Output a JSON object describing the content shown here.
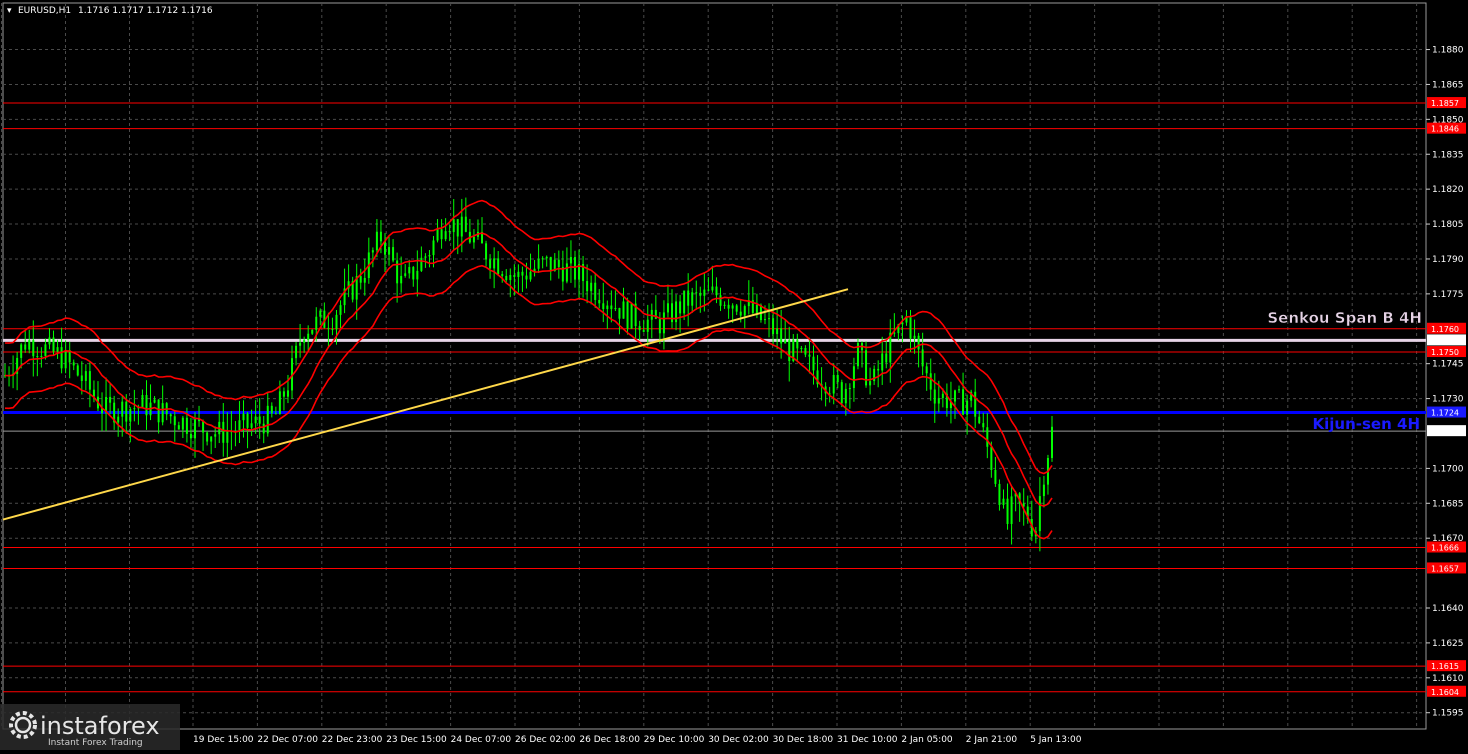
{
  "header": {
    "symbol": "EURUSD,H1",
    "ohlc": "1.1716 1.1717 1.1712 1.1716"
  },
  "chart_data": {
    "type": "candlestick",
    "instrument": "EURUSD",
    "timeframe": "H1",
    "ylim": [
      1.1588,
      1.19
    ],
    "grid": true,
    "price_ticks": [
      "1.1880",
      "1.1865",
      "1.1850",
      "1.1835",
      "1.1820",
      "1.1805",
      "1.1790",
      "1.1775",
      "1.1745",
      "1.1730",
      "1.1700",
      "1.1685",
      "1.1670",
      "1.1640",
      "1.1625",
      "1.1610",
      "1.1595"
    ],
    "time_ticks": [
      "19 Dec 15:00",
      "22 Dec 07:00",
      "22 Dec 23:00",
      "23 Dec 15:00",
      "24 Dec 07:00",
      "26 Dec 02:00",
      "26 Dec 18:00",
      "29 Dec 10:00",
      "30 Dec 02:00",
      "30 Dec 18:00",
      "31 Dec 10:00",
      "2 Jan 05:00",
      "2 Jan 21:00",
      "5 Jan 13:00"
    ],
    "levels": [
      {
        "value": 1.1857,
        "label": "1.1857",
        "color": "#ff0000"
      },
      {
        "value": 1.1846,
        "label": "1.1846",
        "color": "#ff0000"
      },
      {
        "value": 1.176,
        "label": "1.1760",
        "color": "#ff0000"
      },
      {
        "value": 1.175,
        "label": "1.1750",
        "color": "#ff0000"
      },
      {
        "value": 1.1666,
        "label": "1.1666",
        "color": "#ff0000"
      },
      {
        "value": 1.1657,
        "label": "1.1657",
        "color": "#ff0000"
      },
      {
        "value": 1.1615,
        "label": "1.1615",
        "color": "#ff0000"
      },
      {
        "value": 1.1604,
        "label": "1.1604",
        "color": "#ff0000"
      }
    ],
    "senkou": {
      "value": 1.1755,
      "label": "1.1755",
      "name": "Senkou Span B 4H",
      "color": "#e6d3e6"
    },
    "kijun": {
      "value": 1.1724,
      "label": "1.1724",
      "name": "Kijun-sen 4H",
      "color": "#0000ff"
    },
    "current": {
      "value": 1.1716,
      "label": "1.1716"
    },
    "trendline": {
      "from": [
        "17 Dec",
        1.1678
      ],
      "to": [
        "31 Dec",
        1.1777
      ],
      "color": "#ffd84a"
    },
    "candle_color": "#00ff00",
    "indicator_color": "#ff0000"
  },
  "watermark": {
    "brand": "instaforex",
    "tagline": "Instant Forex Trading"
  }
}
